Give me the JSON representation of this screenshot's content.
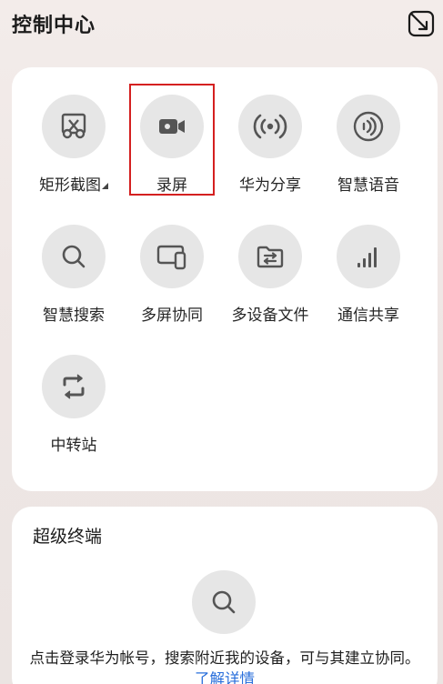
{
  "header": {
    "title": "控制中心"
  },
  "tiles": [
    {
      "label": "矩形截图",
      "icon": "crop-screenshot-icon"
    },
    {
      "label": "录屏",
      "icon": "video-camera-icon"
    },
    {
      "label": "华为分享",
      "icon": "wireless-share-icon"
    },
    {
      "label": "智慧语音",
      "icon": "voice-assistant-icon"
    },
    {
      "label": "智慧搜索",
      "icon": "search-icon"
    },
    {
      "label": "多屏协同",
      "icon": "multi-screen-icon"
    },
    {
      "label": "多设备文件",
      "icon": "folder-transfer-icon"
    },
    {
      "label": "通信共享",
      "icon": "signal-bars-icon"
    },
    {
      "label": "中转站",
      "icon": "transfer-loop-icon"
    }
  ],
  "super_device": {
    "title": "超级终端",
    "description": "点击登录华为帐号，搜索附近我的设备，可与其建立协同。",
    "link_text": "了解详情"
  },
  "colors": {
    "highlight": "#d42020",
    "link": "#2a6fdb",
    "icon": "#555555"
  }
}
